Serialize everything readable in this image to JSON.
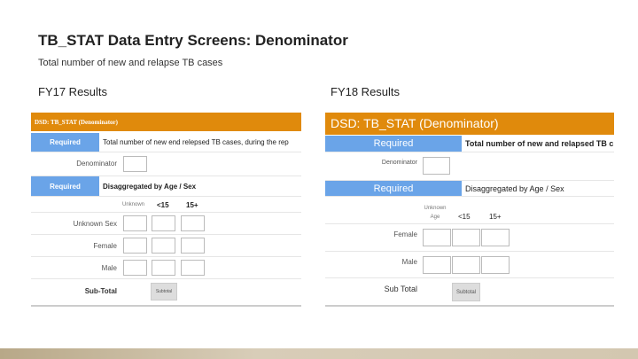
{
  "title": "TB_STAT Data Entry Screens: Denominator",
  "subtitle": "Total number of new and relapse TB cases",
  "fy17": {
    "heading": "FY17 Results",
    "form_title": "DSD: TB_STAT (Denominator)",
    "required1": "Required",
    "required1_text": "Total number of new end relepsed TB cases, during the rep",
    "denominator_label": "Denominator",
    "required2": "Required",
    "required2_text": "Disaggregated by Age / Sex",
    "col_unknown": "Unknown",
    "col_lt15": "<15",
    "col_15plus": "15+",
    "rows": [
      "Unknown Sex",
      "Female",
      "Male"
    ],
    "subtotal_label": "Sub-Total",
    "subtotal_button": "Subtotal"
  },
  "fy18": {
    "heading": "FY18 Results",
    "form_title": "DSD: TB_STAT (Denominator)",
    "required1": "Required",
    "required1_text": "Total number of new and relapsed TB c",
    "denominator_label": "Denominator",
    "required2": "Required",
    "required2_text": "Disaggregated by Age / Sex",
    "col_unknown": "Unknown Age",
    "col_lt15": "<15",
    "col_15plus": "15+",
    "rows": [
      "Female",
      "Male"
    ],
    "subtotal_label": "Sub Total",
    "subtotal_button": "Subtotal"
  }
}
